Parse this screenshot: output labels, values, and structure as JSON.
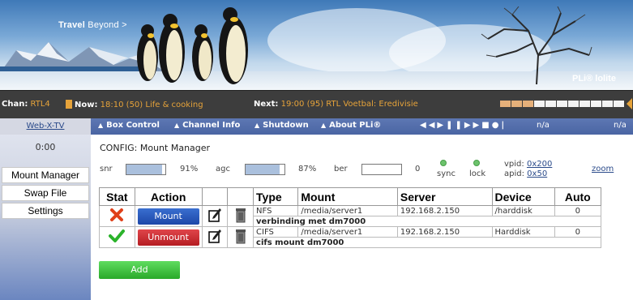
{
  "banner": {
    "tagline_bold": "Travel",
    "tagline_thin": "Beyond",
    "tagline_arrow": ">",
    "logo": "PLi® lolite"
  },
  "now_next": {
    "chan_label": "Chan:",
    "channel": "RTL4",
    "now_label": "Now:",
    "now_text": "18:10 (50) Life & cooking",
    "next_label": "Next:",
    "next_text": "19:00 (95) RTL Voetbal: Eredivisie",
    "progress_filled": 3,
    "progress_total": 11
  },
  "nav": {
    "webx": "Web-X-TV",
    "items": [
      "Box Control",
      "Channel Info",
      "Shutdown",
      "About PLi®"
    ],
    "na_left": "n/a",
    "na_right": "n/a"
  },
  "sidebar": {
    "clock": "0:00",
    "items": [
      "Mount Manager",
      "Swap File",
      "Settings"
    ]
  },
  "config": {
    "title": "CONFIG: Mount Manager",
    "snr_label": "snr",
    "snr_value": "91%",
    "snr_level": 0.91,
    "agc_label": "agc",
    "agc_value": "87%",
    "agc_level": 0.87,
    "ber_label": "ber",
    "ber_value": "0",
    "ber_level": 0,
    "sync_label": "sync",
    "lock_label": "lock",
    "vpid_label": "vpid:",
    "vpid_value": "0x200",
    "apid_label": "apid:",
    "apid_value": "0x50",
    "zoom": "zoom"
  },
  "table": {
    "headers": [
      "Stat",
      "Action",
      "",
      "",
      "Type",
      "Mount",
      "Server",
      "Device",
      "Auto"
    ],
    "rows": [
      {
        "status": "error",
        "action": "Mount",
        "type": "NFS",
        "mount": "/media/server1",
        "server": "192.168.2.150",
        "device": "/harddisk",
        "auto": "0",
        "note": "verbinding met dm7000"
      },
      {
        "status": "ok",
        "action": "Unmount",
        "type": "CIFS",
        "mount": "/media/server1",
        "server": "192.168.2.150",
        "device": "Harddisk",
        "auto": "0",
        "note": "cifs mount dm7000"
      }
    ],
    "add_label": "Add"
  },
  "colors": {
    "accent_orange": "#e6a33a",
    "nav_blue": "#4a65a3",
    "mount_blue": "#1d47a8",
    "unmount_red": "#b51d22",
    "add_green": "#2aa92a"
  }
}
